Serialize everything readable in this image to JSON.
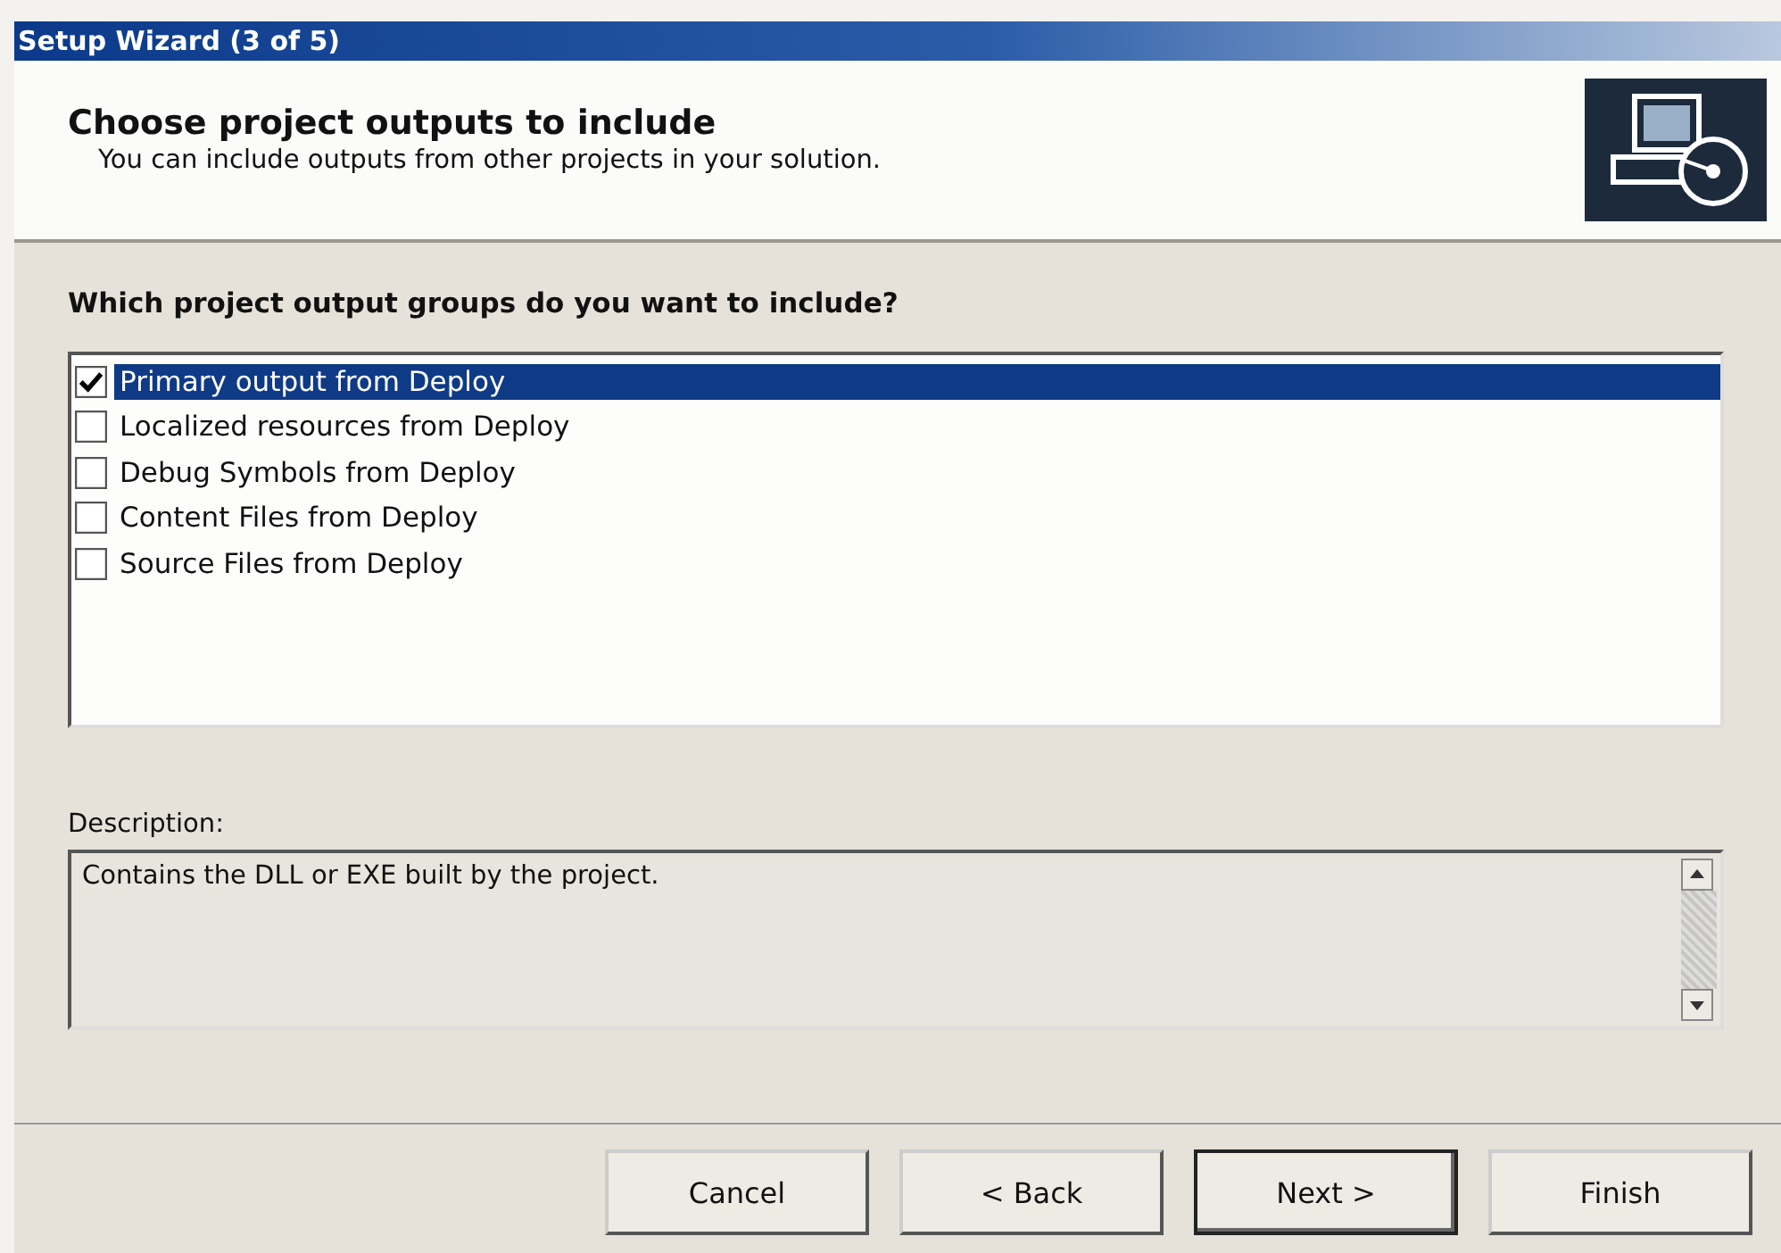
{
  "window": {
    "title": "Setup Wizard (3 of 5)"
  },
  "header": {
    "title": "Choose project outputs to include",
    "subtitle": "You can include outputs from other projects in your solution."
  },
  "question": "Which project output groups do you want to include?",
  "output_groups": [
    {
      "label": "Primary output from Deploy",
      "checked": true,
      "selected": true
    },
    {
      "label": "Localized resources from Deploy",
      "checked": false,
      "selected": false
    },
    {
      "label": "Debug Symbols from Deploy",
      "checked": false,
      "selected": false
    },
    {
      "label": "Content Files from Deploy",
      "checked": false,
      "selected": false
    },
    {
      "label": "Source Files from Deploy",
      "checked": false,
      "selected": false
    }
  ],
  "description": {
    "label": "Description:",
    "text": "Contains the DLL or EXE built by the project."
  },
  "buttons": [
    {
      "label": "Cancel",
      "default": false
    },
    {
      "label": "< Back",
      "default": false
    },
    {
      "label": "Next >",
      "default": true
    },
    {
      "label": "Finish",
      "default": false
    }
  ]
}
